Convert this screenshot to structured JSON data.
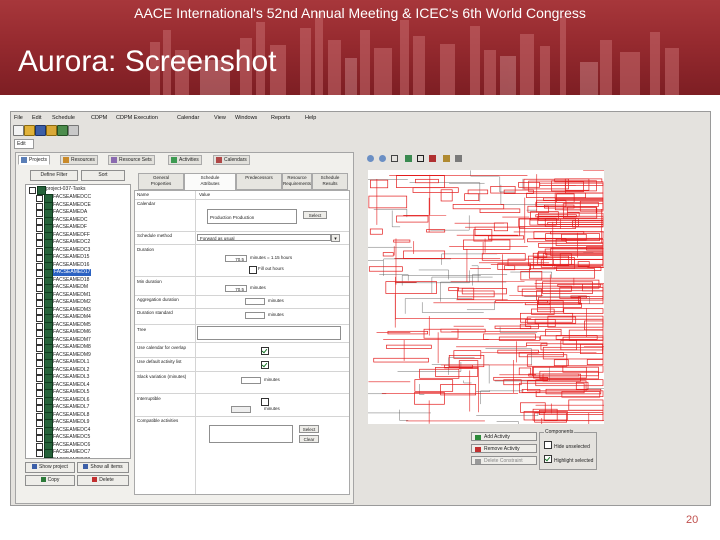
{
  "slide": {
    "header": "AACE International's 52nd Annual Meeting & ICEC's 6th World Congress",
    "title": "Aurora: Screenshot",
    "page_number": "20",
    "accent_color": "#9e2a2f"
  },
  "app": {
    "menu": [
      "File",
      "Edit",
      "Schedule",
      "CDPM",
      "CDPM Execution",
      "Calendar",
      "View",
      "Windows",
      "Reports",
      "Help"
    ],
    "toolbar_icons": [
      "new-icon",
      "open-icon",
      "save-icon",
      "undo-icon",
      "redo-icon",
      "print-icon"
    ],
    "edit_tab": "Edit",
    "panel_tabs": [
      {
        "label": "Projects",
        "icon": "project-icon",
        "active": true
      },
      {
        "label": "Resources",
        "icon": "resource-icon",
        "active": false
      },
      {
        "label": "Resource Sets",
        "icon": "resource-set-icon",
        "active": false
      },
      {
        "label": "Activities",
        "icon": "activity-icon",
        "active": false
      },
      {
        "label": "Calendars",
        "icon": "calendar-icon",
        "active": false
      }
    ],
    "tree_buttons": {
      "define_filter": "Define Filter",
      "sort": "Sort"
    },
    "tree_root": "project-037-Tasks",
    "tree_items": [
      "FACSEAMEDCC",
      "FACSEAMEDCE",
      "FACSEAMEDA",
      "FACSEAMEDC",
      "FACSEAMEDF",
      "FACSEAMEDFF",
      "FACSEAMEDC2",
      "FACSEAMEDC3",
      "FACSEAMED15",
      "FACSEAMED16",
      "FACSEAMED17",
      "FACSEAMED18",
      "FACSEAMEDM",
      "FACSEAMEDM1",
      "FACSEAMEDM2",
      "FACSEAMEDM3",
      "FACSEAMEDM4",
      "FACSEAMEDM5",
      "FACSEAMEDM6",
      "FACSEAMEDM7",
      "FACSEAMEDM8",
      "FACSEAMEDM9",
      "FACSEAMEDL1",
      "FACSEAMEDL2",
      "FACSEAMEDL3",
      "FACSEAMEDL4",
      "FACSEAMEDL5",
      "FACSEAMEDL6",
      "FACSEAMEDL7",
      "FACSEAMEDL8",
      "FACSEAMEDL9",
      "FACSEAMEDC4",
      "FACSEAMEDC5",
      "FACSEAMEDC6",
      "FACSEAMEDC7",
      "FACSEAMEDC8",
      "FACSEAMEDC9",
      "FACSEAMEDX1",
      "FACSEAMEDX2"
    ],
    "selected_index": 10,
    "tree_footer": {
      "show_project": "Show project",
      "show_all_items": "Show all items",
      "copy": "Copy",
      "delete": "Delete"
    },
    "prop_tabs": [
      {
        "label": "General",
        "label2": "Properties",
        "active": false
      },
      {
        "label": "Schedule",
        "label2": "Attributes",
        "active": true
      },
      {
        "label": "Predecessors",
        "label2": "",
        "active": false
      },
      {
        "label": "Resource",
        "label2": "Requirements",
        "active": false
      },
      {
        "label": "Schedule",
        "label2": "Results",
        "active": false
      }
    ],
    "props": {
      "col_name": "Name",
      "col_value": "Value",
      "calendar_label": "Calendar",
      "calendar_value": "Production Production",
      "select_label": "Select",
      "schedule_method_label": "Schedule method",
      "schedule_method_value": "Forward as usual",
      "duration_label": "Duration",
      "duration_value": "70.5",
      "duration_units": "minutes = 1.15 hours",
      "hours_label": "Fill out hours",
      "min_duration_label": "Min duration",
      "min_duration_value": "70.5",
      "min_duration_units": "minutes",
      "agg_duration_label": "Aggregation duration",
      "agg_units": "minutes",
      "duration_standard_label": "Duration standard",
      "tree_label": "Tree",
      "use_calendar_label": "Use calendar for overlap",
      "use_calendar_checked": true,
      "use_default_label": "Use default activity list",
      "use_default_checked": true,
      "slack_label": "Slack variation (minutes)",
      "slack_units": "minutes",
      "interruptible_label": "Interruptible",
      "interruptible_checked": false,
      "interrupt_units": "minutes",
      "compatible_label": "Compatible activities",
      "select2_label": "Select",
      "clear_label": "Clear"
    },
    "right_tools": [
      "zoom-in-icon",
      "zoom-out-icon",
      "fit-icon",
      "select-icon",
      "pan-icon",
      "stop-icon",
      "lock-icon",
      "settings-icon"
    ],
    "actions": {
      "add": "Add Activity",
      "remove": "Remove Activity",
      "delete_constraint": "Delete Constraint"
    },
    "components": {
      "title": "Components",
      "option1": "Hide unselected",
      "option1_checked": false,
      "option2": "Highlight selected",
      "option2_checked": true
    }
  }
}
